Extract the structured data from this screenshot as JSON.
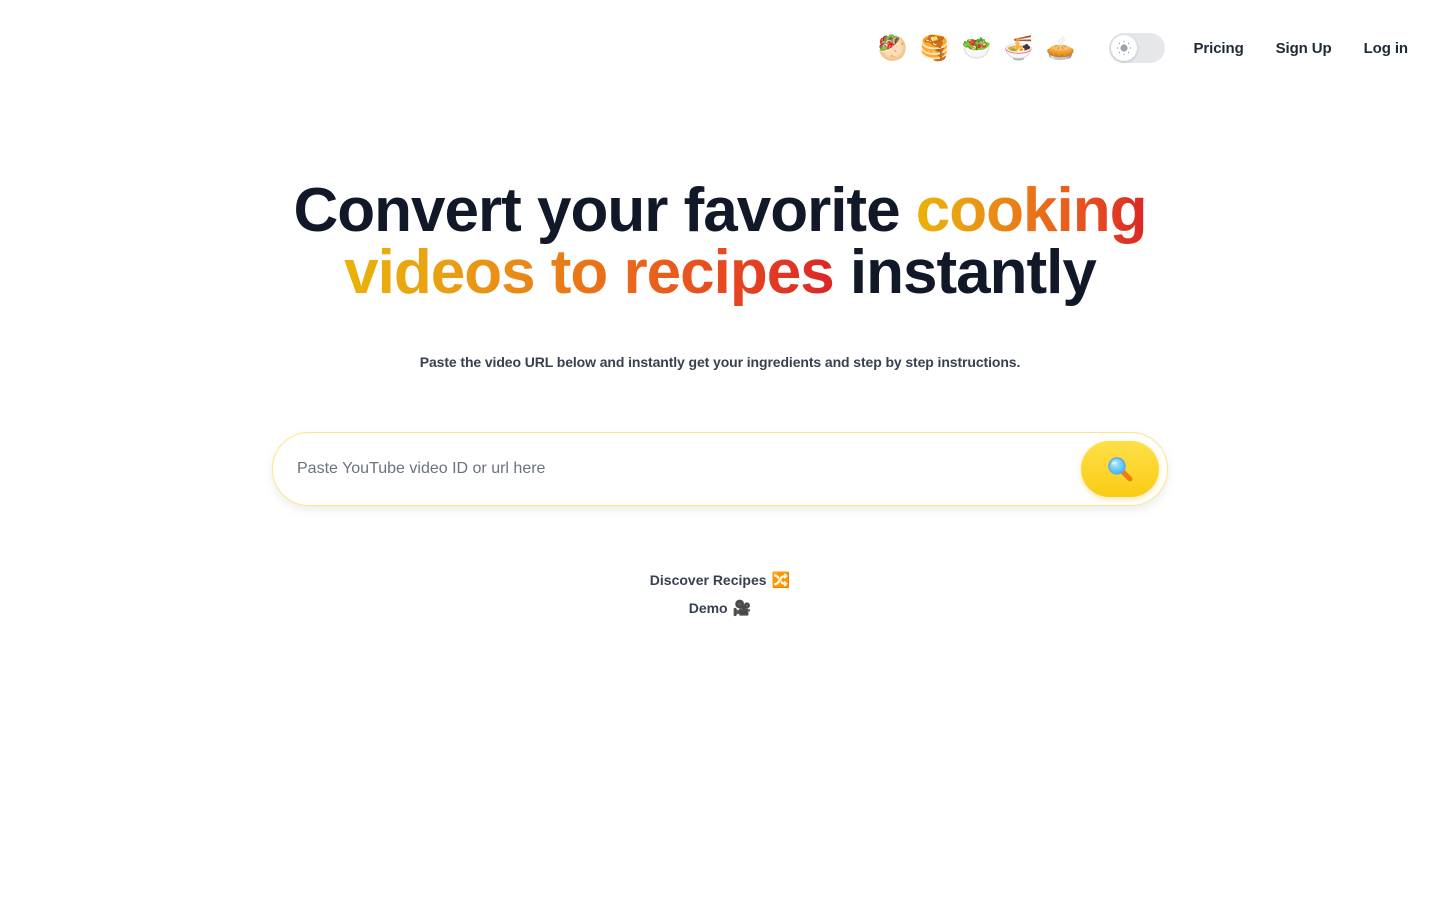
{
  "header": {
    "food_emojis": [
      {
        "name": "stuffed-flatbread",
        "glyph": "🥙"
      },
      {
        "name": "pancakes",
        "glyph": "🥞"
      },
      {
        "name": "green-salad",
        "glyph": "🥗"
      },
      {
        "name": "steaming-bowl",
        "glyph": "🍜"
      },
      {
        "name": "pie",
        "glyph": "🥧"
      }
    ],
    "theme_toggle": {
      "state": "light",
      "icon": "sun-icon"
    },
    "nav": {
      "pricing": "Pricing",
      "sign_up": "Sign Up",
      "log_in": "Log in"
    }
  },
  "hero": {
    "title_part1": "Convert your favorite ",
    "title_highlight_1": "cooking",
    "title_highlight_2": "videos to recipes",
    "title_part2": " instantly",
    "subtitle": "Paste the video URL below and instantly get your ingredients and step by step instructions."
  },
  "search": {
    "value": "",
    "placeholder": "Paste YouTube video ID or url here",
    "button_icon": "magnifying-glass-icon"
  },
  "links": {
    "discover": "Discover Recipes",
    "discover_emoji": "🔀",
    "demo": "Demo",
    "demo_emoji": "🎥"
  },
  "colors": {
    "gradient_start": "#eab308",
    "gradient_mid": "#ea7b17",
    "gradient_end": "#dc2626",
    "heading": "#111827",
    "search_button": "#facc15",
    "search_border": "#fde68a"
  }
}
